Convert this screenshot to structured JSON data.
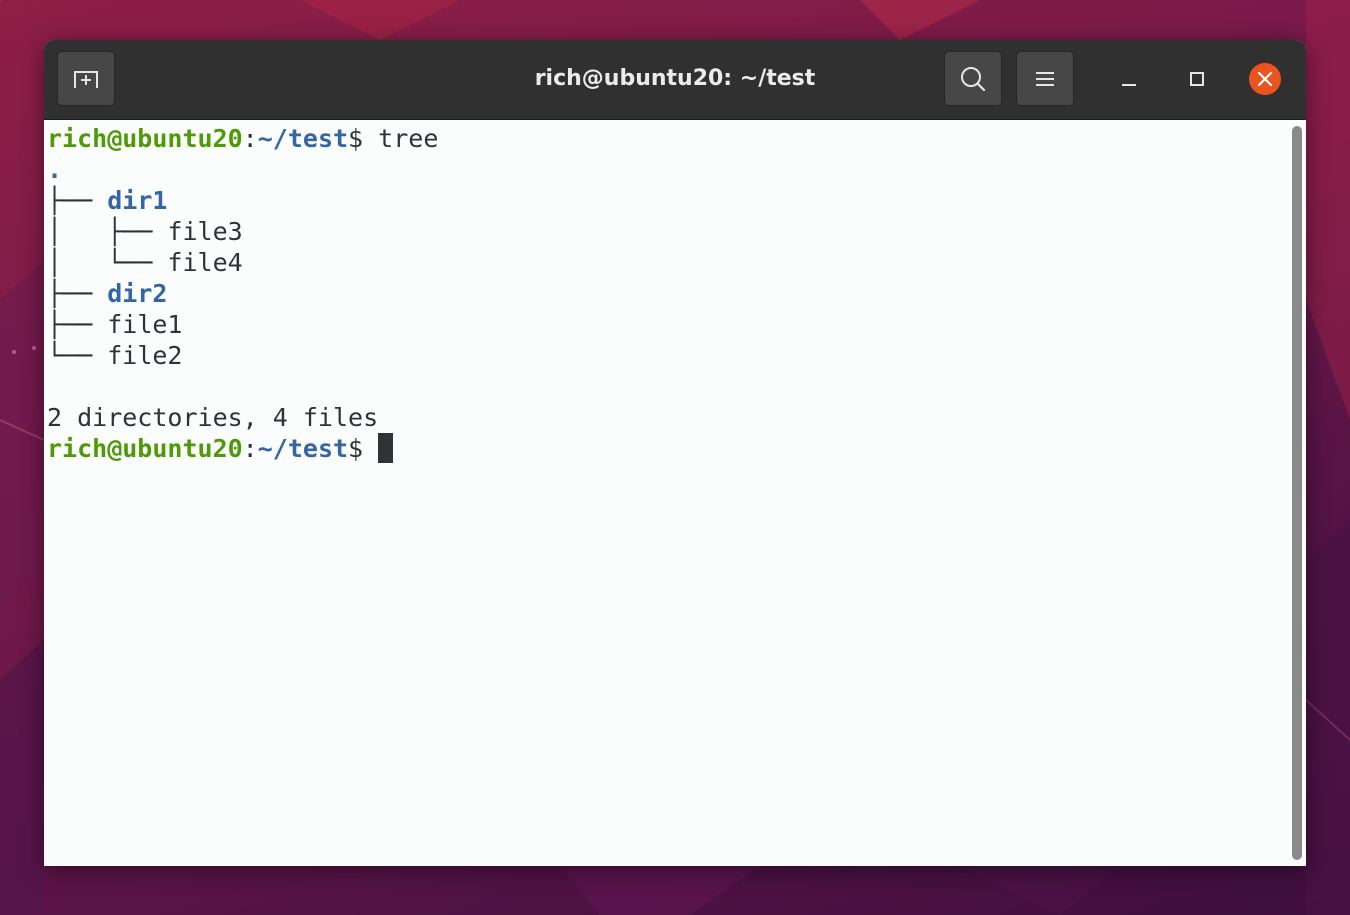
{
  "window": {
    "title": "rich@ubuntu20: ~/test"
  },
  "headerbar": {
    "new_tab_icon": "new-tab-icon",
    "search_icon": "search-icon",
    "menu_icon": "hamburger-menu-icon",
    "minimize_icon": "minimize-icon",
    "maximize_icon": "maximize-icon",
    "close_icon": "close-icon"
  },
  "terminal": {
    "prompt_user": "rich@ubuntu20",
    "prompt_sep": ":",
    "prompt_path": "~/test",
    "prompt_dollar": "$",
    "command": " tree",
    "tree_root": ".",
    "tree": [
      {
        "prefix": "├── ",
        "name": "dir1",
        "is_dir": true
      },
      {
        "prefix": "│   ├── ",
        "name": "file3",
        "is_dir": false
      },
      {
        "prefix": "│   └── ",
        "name": "file4",
        "is_dir": false
      },
      {
        "prefix": "├── ",
        "name": "dir2",
        "is_dir": true
      },
      {
        "prefix": "├── ",
        "name": "file1",
        "is_dir": false
      },
      {
        "prefix": "└── ",
        "name": "file2",
        "is_dir": false
      }
    ],
    "summary": "2 directories, 4 files"
  },
  "colors": {
    "prompt_user": "#4e9a06",
    "prompt_path": "#3465a4",
    "directory": "#3465a4",
    "text": "#2e3436",
    "close_button": "#e95420",
    "headerbar": "#303030"
  }
}
